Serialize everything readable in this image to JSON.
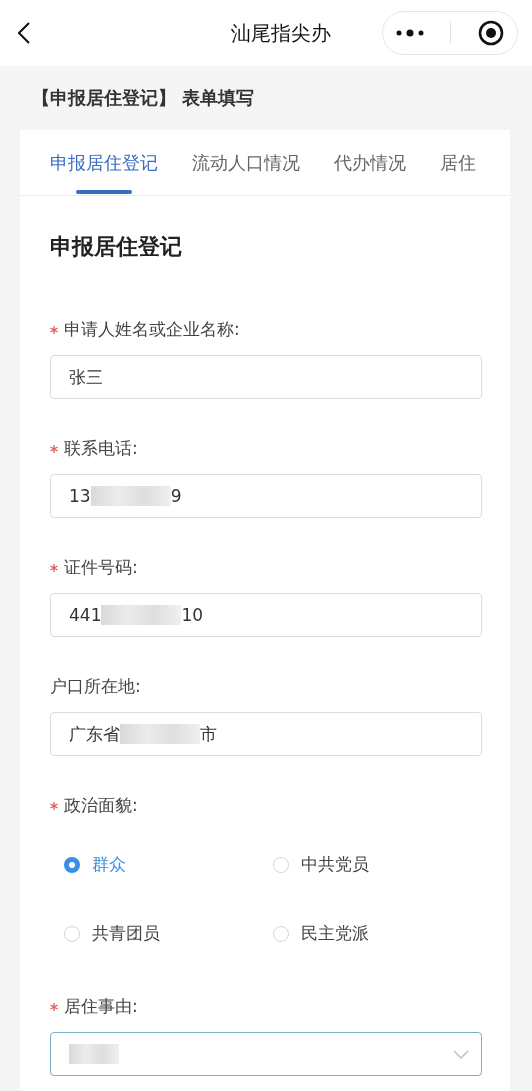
{
  "nav_bar": {
    "title": "汕尾指尖办"
  },
  "page_title": "【申报居住登记】 表单填写",
  "tabs": [
    {
      "label": "申报居住登记",
      "selected": true
    },
    {
      "label": "流动人口情况",
      "selected": false
    },
    {
      "label": "代办情况",
      "selected": false
    },
    {
      "label": "居住",
      "selected": false
    }
  ],
  "section_title": "申报居住登记",
  "fields": [
    {
      "kind": "input",
      "label": "申请人姓名或企业名称:",
      "required": true,
      "value_parts": [
        {
          "kind": "text",
          "text": "张三"
        }
      ]
    },
    {
      "kind": "input",
      "label": "联系电话:",
      "required": true,
      "value_parts": [
        {
          "kind": "text",
          "text": "13"
        },
        {
          "kind": "blur"
        },
        {
          "kind": "text",
          "text": "9"
        }
      ]
    },
    {
      "kind": "input",
      "label": "证件号码:",
      "required": true,
      "value_parts": [
        {
          "kind": "text",
          "text": "441"
        },
        {
          "kind": "blur"
        },
        {
          "kind": "text",
          "text": "10"
        }
      ]
    },
    {
      "kind": "input",
      "label": "户口所在地:",
      "required": false,
      "value_parts": [
        {
          "kind": "text",
          "text": "广东省"
        },
        {
          "kind": "blur"
        },
        {
          "kind": "text",
          "text": "市"
        }
      ]
    },
    {
      "kind": "radio",
      "label": "政治面貌:",
      "required": true,
      "options": [
        {
          "label": "群众",
          "selected": true
        },
        {
          "label": "中共党员",
          "selected": false
        },
        {
          "label": "共青团员",
          "selected": false
        },
        {
          "label": "民主党派",
          "selected": false
        }
      ]
    },
    {
      "kind": "select",
      "label": "居住事由:",
      "required": true,
      "focused": true,
      "value_parts": [
        {
          "kind": "blur"
        }
      ]
    }
  ]
}
